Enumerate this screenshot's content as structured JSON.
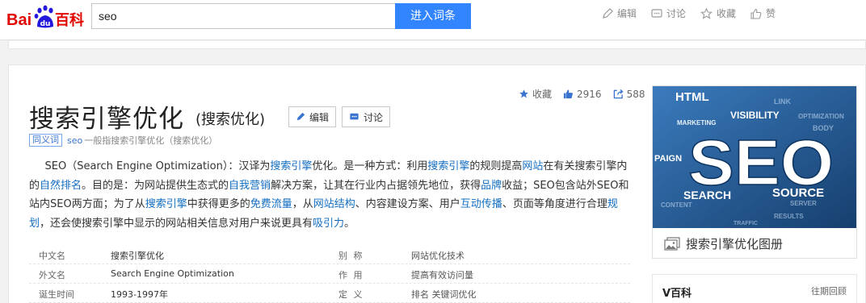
{
  "header": {
    "logo_text_1": "Bai",
    "logo_text_2": "百科",
    "search_value": "seo",
    "search_button": "进入词条",
    "actions": [
      {
        "icon": "pencil-icon",
        "label": "编辑"
      },
      {
        "icon": "discuss-icon",
        "label": "讨论"
      },
      {
        "icon": "star-icon",
        "label": "收藏"
      },
      {
        "icon": "thumb-up-icon",
        "label": "赞"
      }
    ]
  },
  "stats": {
    "favorite_label": "收藏",
    "likes": "2916",
    "shares": "588"
  },
  "entry": {
    "title": "搜索引擎优化",
    "subtitle": "(搜索优化)",
    "edit_label": "编辑",
    "discuss_label": "讨论",
    "synonym_badge": "同义词",
    "synonym_link": "seo",
    "synonym_text": "一般指搜索引擎优化（搜索优化）"
  },
  "intro": [
    {
      "t": "SEO（Search Engine Optimization）：汉译为"
    },
    {
      "t": "搜索引擎",
      "link": true
    },
    {
      "t": "优化。是一种方式：利用"
    },
    {
      "t": "搜索引擎",
      "link": true
    },
    {
      "t": "的规则提高"
    },
    {
      "t": "网站",
      "link": true
    },
    {
      "t": "在有关搜索引擎内的"
    },
    {
      "t": "自然排名",
      "link": true
    },
    {
      "t": "。目的是：为网站提供生态式的"
    },
    {
      "t": "自我营销",
      "link": true
    },
    {
      "t": "解决方案，让其在行业内占据领先地位，获得"
    },
    {
      "t": "品牌",
      "link": true
    },
    {
      "t": "收益；SEO包含站外SEO和站内SEO两方面；为了从"
    },
    {
      "t": "搜索引擎",
      "link": true
    },
    {
      "t": "中获得更多的"
    },
    {
      "t": "免费流量",
      "link": true
    },
    {
      "t": "，从"
    },
    {
      "t": "网站结构",
      "link": true
    },
    {
      "t": "、内容建设方案、用户"
    },
    {
      "t": "互动传播",
      "link": true
    },
    {
      "t": "、页面等角度进行合理"
    },
    {
      "t": "规划",
      "link": true
    },
    {
      "t": "，还会使搜索引擎中显示的网站相关信息对用户来说更具有"
    },
    {
      "t": "吸引力",
      "link": true
    },
    {
      "t": "。"
    }
  ],
  "basic_info": [
    {
      "k1": "中文名",
      "v1": "搜索引擎优化",
      "k2": "别 称",
      "v2": "网站优化技术"
    },
    {
      "k1": "外文名",
      "v1": "Search Engine Optimization",
      "k2": "作 用",
      "v2": "提高有效访问量"
    },
    {
      "k1": "诞生时间",
      "v1": "1993-1997年",
      "k2": "定 义",
      "v2": "排名 关键词优化"
    }
  ],
  "album": {
    "caption": "搜索引擎优化图册",
    "image_words": {
      "main": "SEO",
      "html": "HTML",
      "search": "SEARCH",
      "source": "SOURCE",
      "visibility": "VISIBILITY",
      "paign": "PAIGN",
      "marketing": "MARKETING"
    }
  },
  "vbaike": {
    "title": "V百科",
    "more": "往期回顾"
  },
  "colors": {
    "accent": "#3385ff",
    "link": "#136ec2",
    "logo_red": "#e10601",
    "logo_blue": "#2319dc"
  }
}
